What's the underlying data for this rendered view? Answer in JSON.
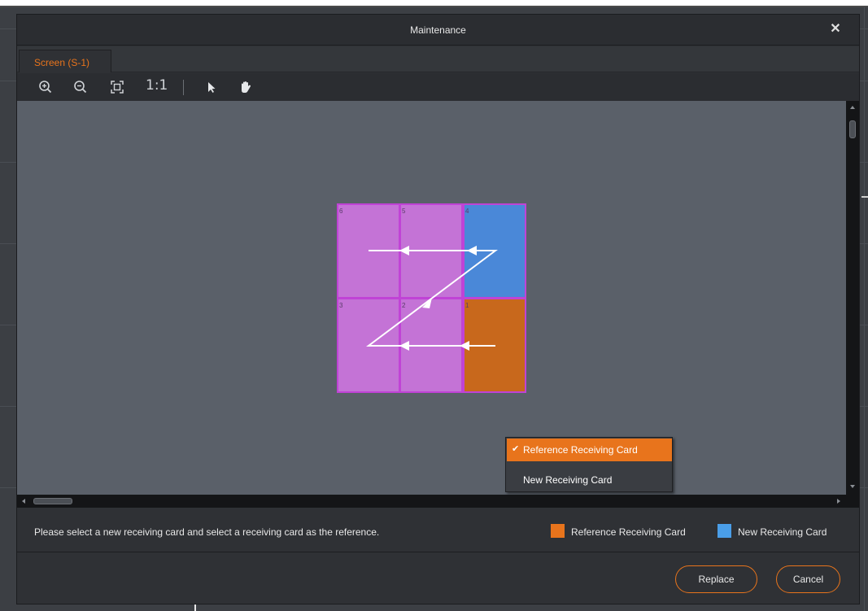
{
  "dialog": {
    "title": "Maintenance",
    "close_symbol": "✕"
  },
  "tabs": [
    {
      "label": "Screen (S-1)",
      "active": true
    }
  ],
  "toolbar": {
    "zoom_in_icon": "zoom-in-icon",
    "zoom_out_icon": "zoom-out-icon",
    "fit_icon": "fit-screen-icon",
    "actual_size_label": "1:1",
    "select_icon": "pointer-icon",
    "pan_icon": "hand-icon"
  },
  "canvas": {
    "cells": [
      {
        "number": "6",
        "color": "#c473d6",
        "row": 0,
        "col": 0
      },
      {
        "number": "5",
        "color": "#c473d6",
        "row": 0,
        "col": 1
      },
      {
        "number": "4",
        "color": "#4a88d8",
        "row": 0,
        "col": 2
      },
      {
        "number": "3",
        "color": "#c473d6",
        "row": 1,
        "col": 0
      },
      {
        "number": "2",
        "color": "#c473d6",
        "row": 1,
        "col": 1
      },
      {
        "number": "1",
        "color": "#c8681c",
        "row": 1,
        "col": 2
      }
    ]
  },
  "context_menu": {
    "items": [
      {
        "label": "Reference Receiving Card",
        "checked": true,
        "check_symbol": "✔"
      },
      {
        "label": "New Receiving Card",
        "checked": false
      }
    ]
  },
  "info": {
    "hint": "Please select a new receiving card and select a receiving card as the reference.",
    "legend": [
      {
        "label": "Reference Receiving Card",
        "color": "#e8741c"
      },
      {
        "label": "New Receiving Card",
        "color": "#4a9ee8"
      }
    ]
  },
  "buttons": {
    "replace_label": "Replace",
    "cancel_label": "Cancel"
  },
  "colors": {
    "accent": "#e8741c",
    "cell_border": "#c043d6"
  }
}
